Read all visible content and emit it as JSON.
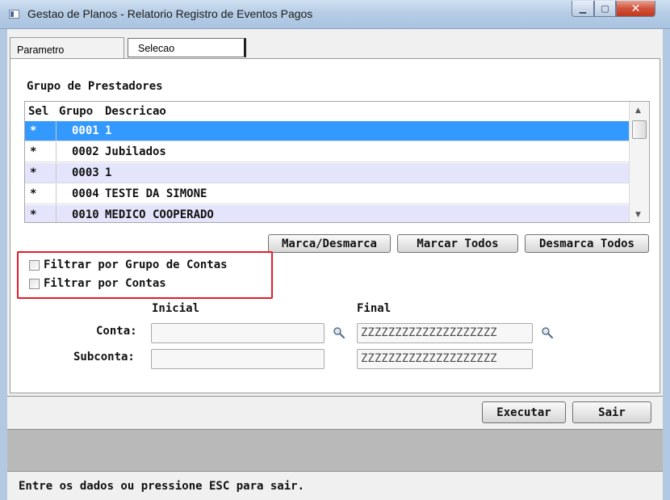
{
  "window": {
    "title": "Gestao de Planos - Relatorio Registro de Eventos Pagos",
    "minimize_glyph": "▁",
    "maximize_glyph": "▢",
    "close_glyph": "✕"
  },
  "tabs": [
    {
      "label": "Parametro",
      "active": false
    },
    {
      "label": "Selecao",
      "active": true
    }
  ],
  "group_section": {
    "title": "Grupo de Prestadores",
    "columns": [
      "Sel",
      "Grupo",
      "Descricao"
    ],
    "rows": [
      {
        "sel": "*",
        "grupo": "0001",
        "descricao": "1",
        "selected": true
      },
      {
        "sel": "*",
        "grupo": "0002",
        "descricao": "Jubilados",
        "selected": false
      },
      {
        "sel": "*",
        "grupo": "0003",
        "descricao": "1",
        "selected": false
      },
      {
        "sel": "*",
        "grupo": "0004",
        "descricao": "TESTE DA SIMONE",
        "selected": false
      },
      {
        "sel": "*",
        "grupo": "0010",
        "descricao": "MEDICO COOPERADO",
        "selected": false
      }
    ],
    "scroll_up_glyph": "▲",
    "scroll_down_glyph": "▼"
  },
  "buttons": {
    "toggle": "Marca/Desmarca",
    "select_all": "Marcar Todos",
    "deselect_all": "Desmarca Todos"
  },
  "filters": {
    "by_account_group": {
      "label": "Filtrar por Grupo de Contas",
      "checked": false
    },
    "by_accounts": {
      "label": "Filtrar por Contas",
      "checked": false
    }
  },
  "range": {
    "initial_label": "Inicial",
    "final_label": "Final",
    "conta_label": "Conta:",
    "subconta_label": "Subconta:",
    "conta_inicial": "",
    "conta_final": "ZZZZZZZZZZZZZZZZZZZZ",
    "subconta_inicial": "",
    "subconta_final": "ZZZZZZZZZZZZZZZZZZZZ"
  },
  "actions": {
    "execute": "Executar",
    "exit": "Sair"
  },
  "status_bar": {
    "message": "Entre os dados ou pressione ESC para sair."
  },
  "colors": {
    "selected_row": "#3399ff",
    "alt_row": "#e4e4fc",
    "highlight_border": "#e11d2c",
    "title_bar": "#b7cde6"
  },
  "icons": {
    "window_icon": "app-window-icon",
    "lookup": "magnifier-icon"
  }
}
